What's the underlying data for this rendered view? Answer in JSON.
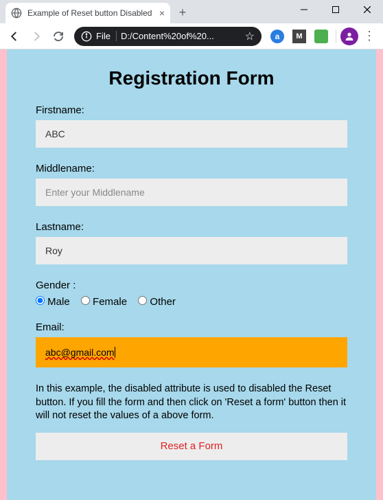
{
  "window": {
    "tab_title": "Example of Reset button Disabled",
    "url_scheme": "File",
    "url_path": "D:/Content%20of%20..."
  },
  "page": {
    "title": "Registration Form",
    "firstname_label": "Firstname:",
    "firstname_value": "ABC",
    "middlename_label": "Middlename:",
    "middlename_placeholder": "Enter your Middlename",
    "lastname_label": "Lastname:",
    "lastname_value": "Roy",
    "gender_label": "Gender :",
    "gender_options": {
      "male": "Male",
      "female": "Female",
      "other": "Other"
    },
    "gender_selected": "male",
    "email_label": "Email:",
    "email_value": "abc@gmail.com",
    "description": "In this example, the disabled attribute is used to disabled the Reset button. If you fill the form and then click on 'Reset a form' button then it will not reset the values of a above form.",
    "reset_label": "Reset a Form"
  }
}
